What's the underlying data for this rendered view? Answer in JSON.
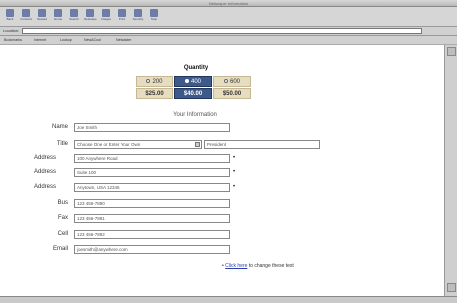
{
  "browser": {
    "window_title": "Netscape: Information",
    "toolbar": [
      {
        "label": "Back",
        "icon": "back-arrow-icon"
      },
      {
        "label": "Forward",
        "icon": "forward-arrow-icon"
      },
      {
        "label": "Reload",
        "icon": "reload-icon"
      },
      {
        "label": "Home",
        "icon": "home-icon"
      },
      {
        "label": "Search",
        "icon": "search-icon"
      },
      {
        "label": "Netscape",
        "icon": "netscape-icon"
      },
      {
        "label": "Images",
        "icon": "images-icon"
      },
      {
        "label": "Print",
        "icon": "print-icon"
      },
      {
        "label": "Security",
        "icon": "security-icon"
      },
      {
        "label": "Stop",
        "icon": "stop-icon"
      }
    ],
    "location_label": "Location:",
    "location_value": "",
    "bookmarks": [
      "Bookmarks",
      "Internet",
      "Lookup",
      "New&Cool",
      "Netcaster"
    ]
  },
  "quantity": {
    "title": "Quantity",
    "options": [
      {
        "label": "200",
        "price": "$25.00",
        "selected": false
      },
      {
        "label": "400",
        "price": "$40.00",
        "selected": true
      },
      {
        "label": "600",
        "price": "$50.00",
        "selected": false
      }
    ]
  },
  "form": {
    "section_title": "Your Information",
    "fields": [
      {
        "label": "Name",
        "value": "Joe Smith",
        "required": false
      },
      {
        "label": "Title",
        "select_value": "Choose One or Enter Your Own",
        "value": "President",
        "required": false
      },
      {
        "label": "Address",
        "value": "100 Anywhere Road",
        "required": true
      },
      {
        "label": "Address",
        "value": "Suite 100",
        "required": true
      },
      {
        "label": "Address",
        "value": "Anytown, USA  12345",
        "required": true
      },
      {
        "label": "Bus",
        "value": "123 456-7890",
        "required": false
      },
      {
        "label": "Fax",
        "value": "123 456-7891",
        "required": false
      },
      {
        "label": "Cell",
        "value": "123 456-7892",
        "required": false
      },
      {
        "label": "Email",
        "value": "joesmith@anywhere.com",
        "required": false
      }
    ]
  },
  "footer": {
    "link_text": "Click here",
    "rest_text": " to change these text"
  },
  "colors": {
    "selected_bg": "#3d5a8a",
    "option_bg": "#e6ddc0",
    "link": "#2a3fb0"
  }
}
